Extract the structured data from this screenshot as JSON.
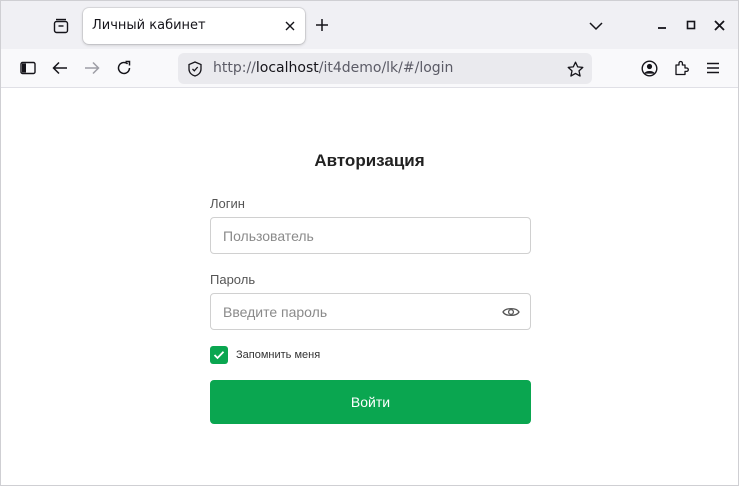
{
  "browser": {
    "tab": {
      "title": "Личный кабинет"
    },
    "url": {
      "scheme": "http://",
      "host": "localhost",
      "path": "/it4demo/lk/#/login"
    },
    "icons": [
      "tab-list-icon",
      "close-icon",
      "plus-icon",
      "chevron-down-icon",
      "minimize-icon",
      "maximize-icon",
      "close-window-icon",
      "sidebar-icon",
      "back-arrow-icon",
      "forward-arrow-icon",
      "reload-icon",
      "shield-icon",
      "star-icon",
      "account-icon",
      "extensions-icon",
      "menu-icon"
    ]
  },
  "login": {
    "title": "Авторизация",
    "login_label": "Логин",
    "login_placeholder": "Пользователь",
    "password_label": "Пароль",
    "password_placeholder": "Введите пароль",
    "remember_label": "Запомнить меня",
    "remember_checked": true,
    "submit_label": "Войти"
  },
  "colors": {
    "accent": "#0aa650",
    "tabstrip_bg": "#f0f0f4",
    "urlbar_bg": "#eaeaee"
  }
}
